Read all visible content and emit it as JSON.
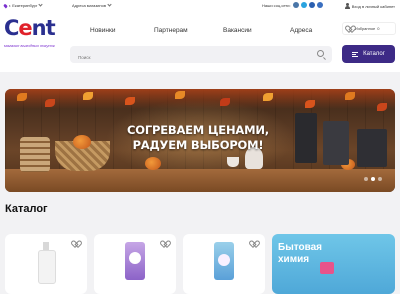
{
  "topbar": {
    "city": "г. Екатеринбург",
    "stores": "Адреса магазинов",
    "social_label": "Наши соц.сети:",
    "social_icons": [
      "vk-icon",
      "telegram-icon",
      "ok-icon",
      "youtube-icon"
    ],
    "login": "Вход в личный кабинет"
  },
  "logo": {
    "word_start": "C",
    "word_e": "e",
    "word_end": "nt",
    "tagline": "магазин выгодных покупок"
  },
  "nav": {
    "items": [
      "Новинки",
      "Партнерам",
      "Вакансии",
      "Адреса"
    ]
  },
  "favorites": {
    "label": "Избранное",
    "count": "0"
  },
  "search": {
    "placeholder": "Поиск"
  },
  "catalog_button": {
    "label": "Каталог"
  },
  "banner": {
    "line1": "СОГРЕВАЕМ ЦЕНАМИ,",
    "line2": "РАДУЕМ ВЫБОРОМ!",
    "slides": 3,
    "active_slide": 2
  },
  "catalog": {
    "title": "Каталог",
    "promo_line1": "Бытовая",
    "promo_line2": "химия"
  },
  "colors": {
    "accent": "#3d2a86",
    "logo_blue": "#2a2f8f",
    "logo_red": "#e0212a",
    "promo": "#5fb6e0"
  }
}
